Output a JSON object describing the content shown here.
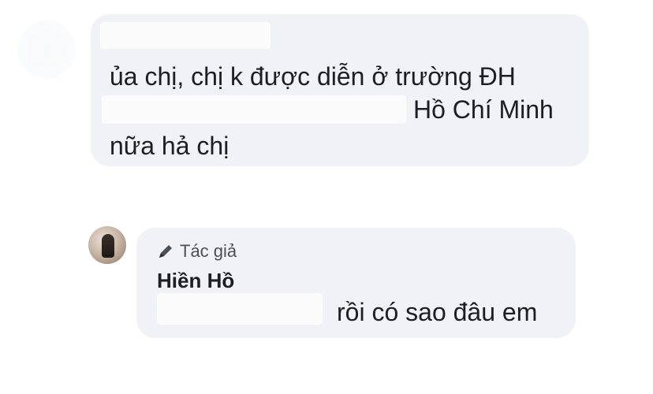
{
  "comment": {
    "text_line_1": "ủa chị, chị k được diễn ở trường ĐH",
    "text_line_2": "Hồ Chí Minh",
    "text_line_3": "nữa hả chị"
  },
  "reply": {
    "badge_label": "Tác giả",
    "badge_icon": "pencil-icon",
    "author_name": "Hiền Hồ",
    "text": "rồi có sao đâu em"
  },
  "colors": {
    "bubble_background": "#f0f2f5",
    "text": "#1c1e21",
    "secondary_text": "#4b4f56"
  }
}
